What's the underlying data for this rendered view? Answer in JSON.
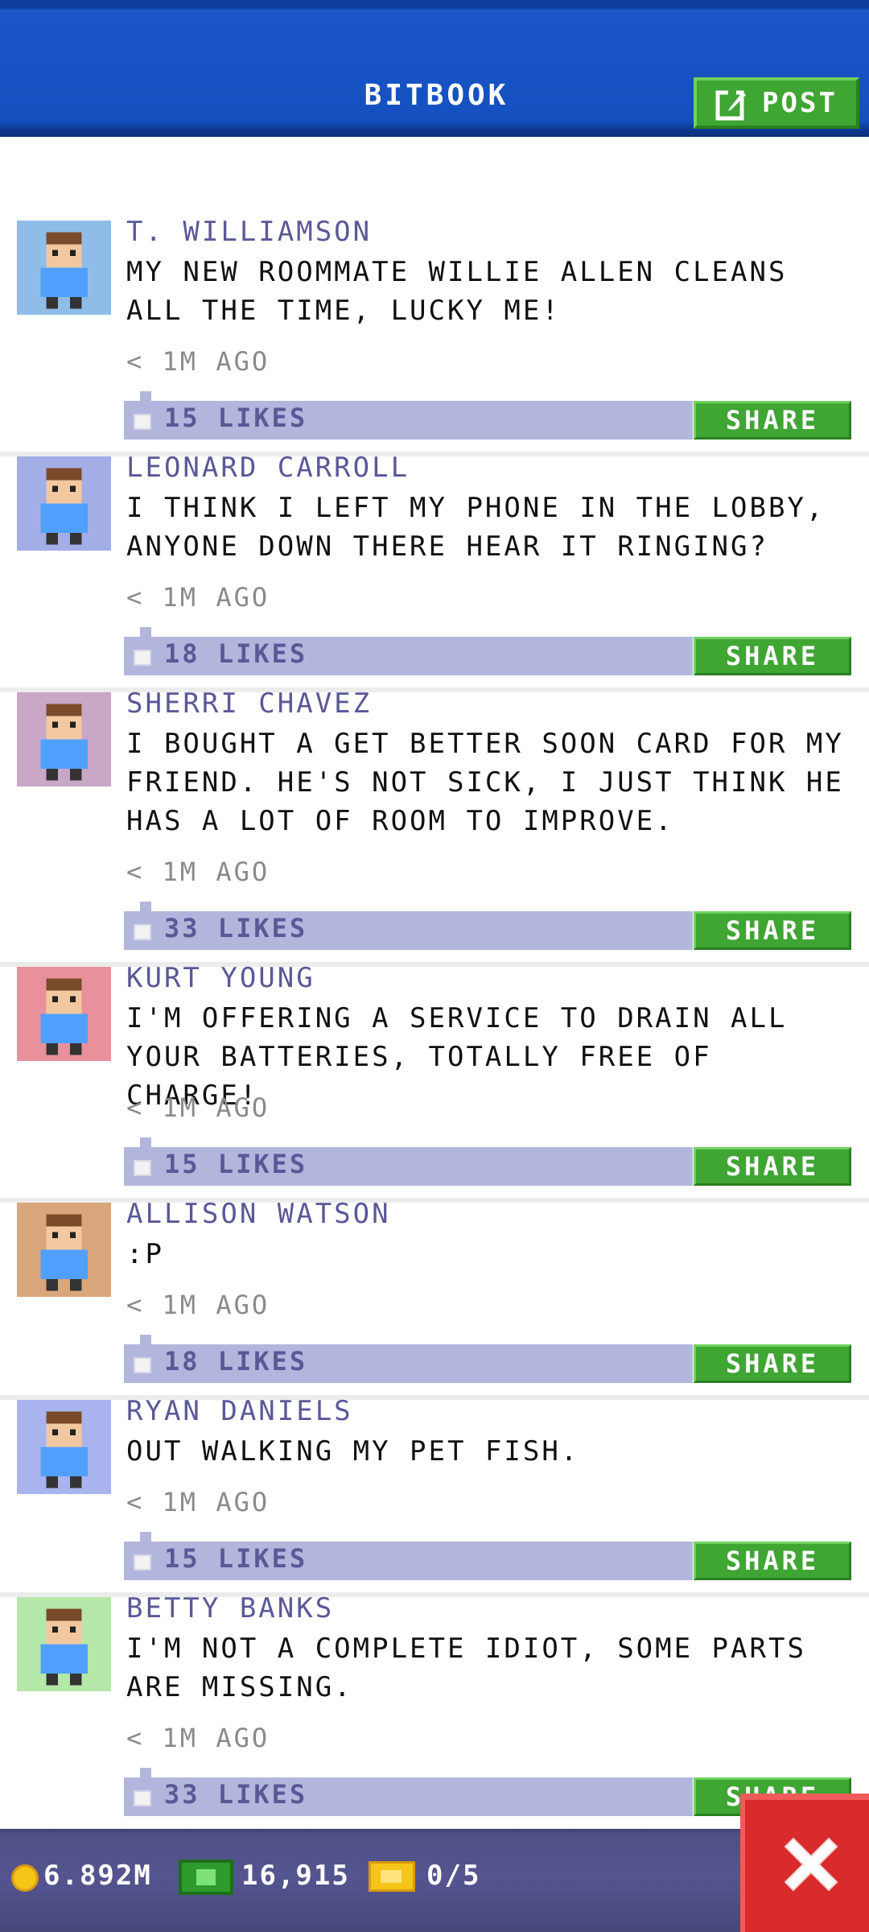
{
  "header": {
    "title": "BITBOOK",
    "post_label": "POST"
  },
  "posts": [
    {
      "author": "T. WILLIAMSON",
      "message": "MY NEW ROOMMATE WILLIE ALLEN CLEANS ALL THE TIME, LUCKY ME!",
      "time": "< 1M AGO",
      "likes": "15 LIKES",
      "share": "SHARE",
      "avatar_bg": "#8fbde8"
    },
    {
      "author": "LEONARD CARROLL",
      "message": "I THINK I LEFT MY PHONE IN THE LOBBY, ANYONE DOWN THERE HEAR IT RINGING?",
      "time": "< 1M AGO",
      "likes": "18 LIKES",
      "share": "SHARE",
      "avatar_bg": "#a3aee6"
    },
    {
      "author": "SHERRI CHAVEZ",
      "message": "I BOUGHT A GET BETTER SOON CARD FOR MY FRIEND. HE'S NOT SICK, I JUST THINK HE HAS A LOT OF ROOM TO IMPROVE.",
      "time": "< 1M AGO",
      "likes": "33 LIKES",
      "share": "SHARE",
      "avatar_bg": "#c9a7c7"
    },
    {
      "author": "KURT YOUNG",
      "message": "I'M OFFERING A SERVICE TO DRAIN ALL YOUR BATTERIES, TOTALLY FREE OF CHARGE!",
      "time": "< 1M AGO",
      "likes": "15 LIKES",
      "share": "SHARE",
      "avatar_bg": "#e8909c"
    },
    {
      "author": "ALLISON WATSON",
      "message": ":P",
      "time": "< 1M AGO",
      "likes": "18 LIKES",
      "share": "SHARE",
      "avatar_bg": "#d9a67c"
    },
    {
      "author": "RYAN DANIELS",
      "message": "OUT WALKING MY PET FISH.",
      "time": "< 1M AGO",
      "likes": "15 LIKES",
      "share": "SHARE",
      "avatar_bg": "#a9b4ef"
    },
    {
      "author": "BETTY BANKS",
      "message": "I'M NOT A COMPLETE IDIOT, SOME PARTS ARE MISSING.",
      "time": "< 1M AGO",
      "likes": "33 LIKES",
      "share": "SHARE",
      "avatar_bg": "#b5e7a8"
    }
  ],
  "status": {
    "coins": "6.892M",
    "bux": "16,915",
    "tickets": "0/5"
  },
  "icons": {
    "post": "edit-icon",
    "coin": "coin-icon",
    "bux": "cash-icon",
    "ticket": "ticket-icon",
    "close": "close-icon",
    "like": "thumb-icon"
  }
}
